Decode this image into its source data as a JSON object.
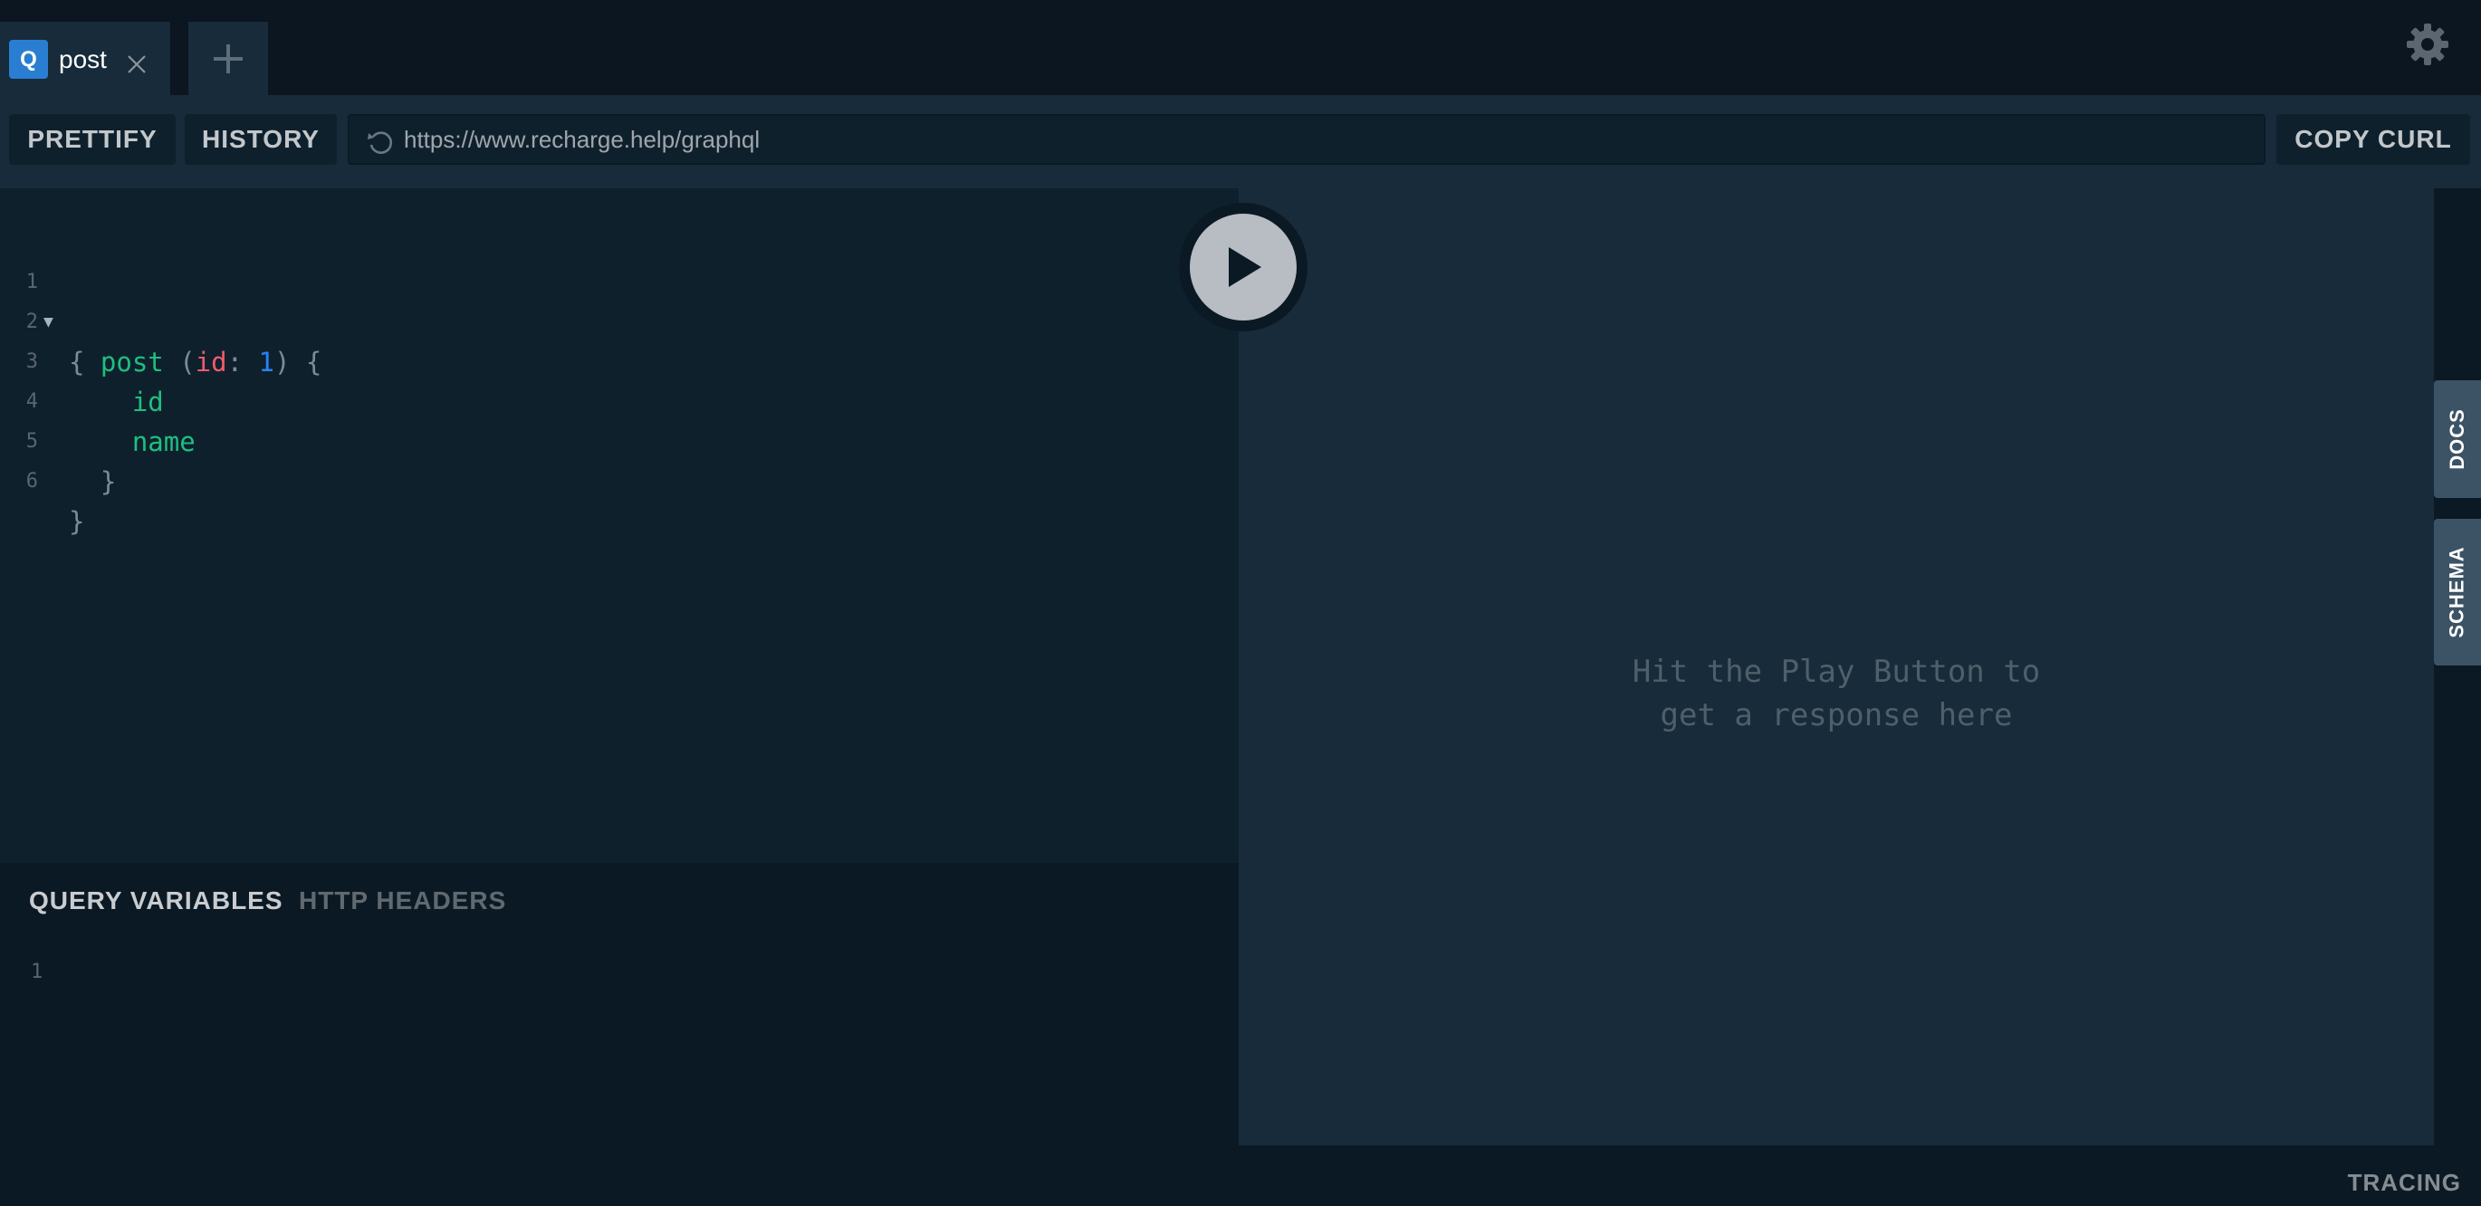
{
  "tabs": [
    {
      "badge": "Q",
      "label": "post"
    }
  ],
  "toolbar": {
    "prettify_label": "PRETTIFY",
    "history_label": "HISTORY",
    "url": "https://www.recharge.help/graphql",
    "copy_curl_label": "COPY CURL"
  },
  "editor": {
    "lines": [
      {
        "num": "1",
        "tokens": [
          "{"
        ]
      },
      {
        "num": "2",
        "tokens": [
          "post",
          " (",
          "id",
          ": ",
          "1",
          ") {"
        ]
      },
      {
        "num": "3",
        "tokens": [
          "id"
        ]
      },
      {
        "num": "4",
        "tokens": [
          "name"
        ]
      },
      {
        "num": "5",
        "tokens": [
          "}"
        ]
      },
      {
        "num": "6",
        "tokens": [
          "}"
        ]
      }
    ]
  },
  "variables_panel": {
    "tab_query_variables": "QUERY VARIABLES",
    "tab_http_headers": "HTTP HEADERS",
    "line_number": "1"
  },
  "result": {
    "hint_line1": "Hit the Play Button to",
    "hint_line2": "get a response here"
  },
  "side_tabs": {
    "docs": "DOCS",
    "schema": "SCHEMA"
  },
  "footer": {
    "tracing_label": "TRACING"
  },
  "icons": {
    "new_tab": "plus-icon",
    "close_tab": "close-icon",
    "settings": "gear-icon",
    "reload": "reload-icon",
    "play": "play-icon",
    "fold": "triangle-down-icon"
  },
  "colors": {
    "tab_badge": "#2a7ed2",
    "field": "#1ebf7e",
    "argument": "#f25c6c",
    "number": "#2882f9",
    "side_tab": "#3b5365"
  }
}
